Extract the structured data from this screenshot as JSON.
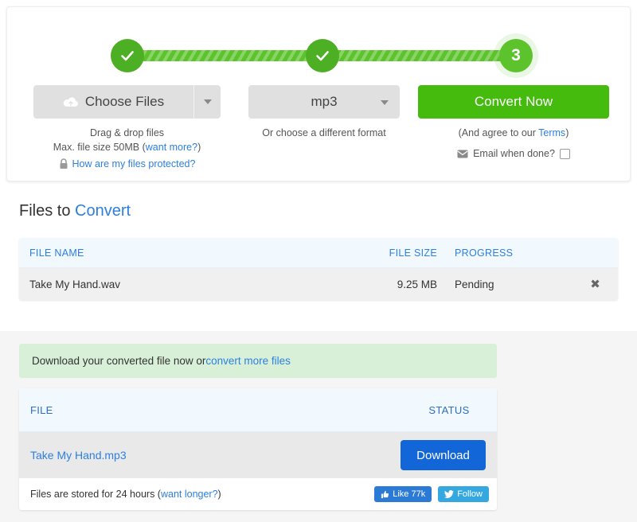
{
  "stepper": {
    "step1_state": "complete",
    "step2_state": "complete",
    "step3_label": "3"
  },
  "controls": {
    "choose_files_label": "Choose Files",
    "choose_files_icon": "cloud-upload-icon",
    "drag_drop_text": "Drag & drop files",
    "max_size_prefix": "Max. file size 50MB (",
    "want_more_link": "want more?",
    "paren_close": ")",
    "protected_link": "How are my files protected?",
    "format_value": "mp3",
    "format_sub": "Or choose a different format",
    "convert_label": "Convert Now",
    "agree_prefix": "(And agree to our ",
    "terms_link": "Terms",
    "agree_suffix": ")",
    "email_label": "Email when done?",
    "email_checked": false
  },
  "files_section": {
    "title_prefix": "Files to ",
    "title_accent": "Convert",
    "headers": {
      "name": "FILE NAME",
      "size": "FILE SIZE",
      "progress": "PROGRESS"
    },
    "rows": [
      {
        "name": "Take My Hand.wav",
        "size": "9.25 MB",
        "progress": "Pending",
        "remove": "✖"
      }
    ]
  },
  "results_section": {
    "notice_prefix": "Download your converted file now or ",
    "notice_link": "convert more files",
    "headers": {
      "file": "FILE",
      "status": "STATUS"
    },
    "rows": [
      {
        "file": "Take My Hand.mp3",
        "action": "Download"
      }
    ],
    "footer_prefix": "Files are stored for 24 hours (",
    "footer_link": "want longer?",
    "footer_suffix": ")",
    "facebook_label": "Like 77k",
    "twitter_label": "Follow"
  },
  "colors": {
    "green_accent": "#44bb0d",
    "step_green": "#4caf24",
    "link_blue": "#2d7fe0",
    "download_blue": "#1266d8",
    "notice_green": "#d8f0d8",
    "header_blue_bg": "#f2f9fe"
  }
}
